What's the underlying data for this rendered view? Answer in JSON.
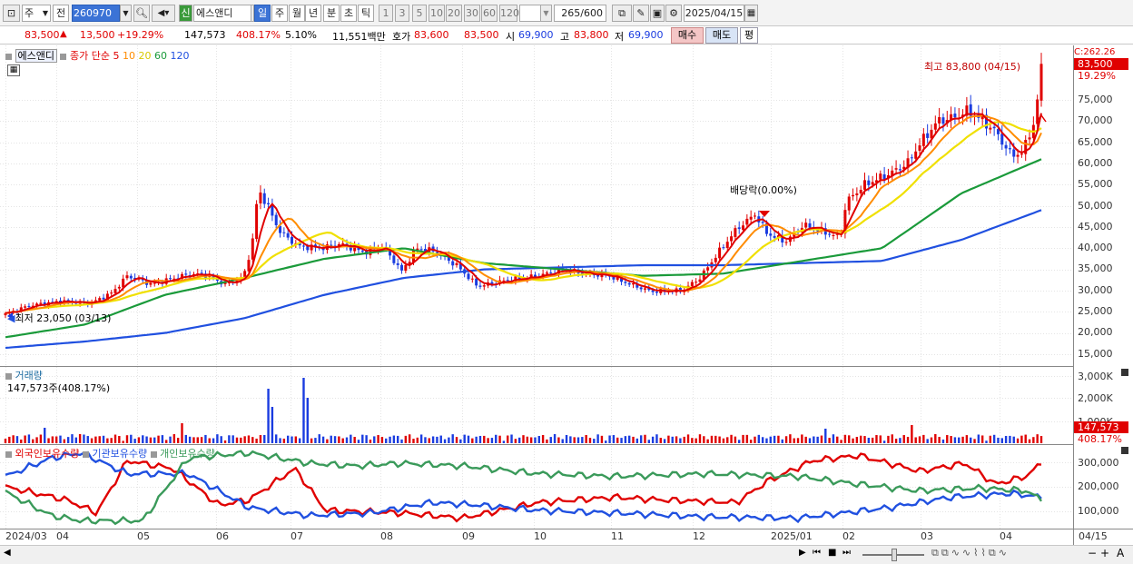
{
  "toolbar": {
    "mkt_label": "주",
    "prev_label": "전",
    "code": "260970",
    "new_badge": "신",
    "stock_name": "에스앤디",
    "periods": [
      "일",
      "주",
      "월",
      "년",
      "분",
      "초",
      "틱"
    ],
    "active_period": "일",
    "intervals": [
      "1",
      "3",
      "5",
      "10",
      "20",
      "30",
      "60",
      "120"
    ],
    "count_value": "265",
    "count_total": "/600",
    "date": "2025/04/15"
  },
  "quote": {
    "price": "83,500",
    "change": "13,500",
    "change_pct": "+19.29%",
    "volume": "147,573",
    "vol_ratio": "408.17%",
    "turnover": "5.10%",
    "amount": "11,551백만",
    "ask_label": "호가",
    "ask": "83,600",
    "bid": "83,500",
    "open_label": "시",
    "open": "69,900",
    "high_label": "고",
    "high": "83,800",
    "low_label": "저",
    "low": "69,900",
    "buy_label": "매수",
    "sell_label": "매도",
    "eval_label": "평"
  },
  "price_pane": {
    "legend_name": "에스앤디",
    "legend_close": "종가 단순 5",
    "legend_ma": [
      "10",
      "20",
      "60",
      "120"
    ],
    "y_labels": [
      "75,000",
      "70,000",
      "65,000",
      "60,000",
      "55,000",
      "50,000",
      "45,000",
      "40,000",
      "35,000",
      "30,000",
      "25,000",
      "20,000",
      "15,000"
    ],
    "cur_price_tag": "83,500",
    "cur_pct_tag": "19.29%",
    "top_tag": "C:262.26",
    "high_note": "최고 83,800 (04/15)",
    "low_note": "최저 23,050 (03/13)",
    "div_note": "배당락(0.00%)"
  },
  "vol_pane": {
    "title": "거래량",
    "value": "147,573주(408.17%)",
    "y_labels": [
      "3,000K",
      "2,000K",
      "1,000K"
    ],
    "cur_tag": "147,573",
    "pct_tag": "408.17%"
  },
  "hold_pane": {
    "legend": [
      "외국인보유수량",
      "기관보유수량",
      "개인보유수량"
    ],
    "y_labels": [
      "300,000",
      "200,000",
      "100,000"
    ]
  },
  "x_labels": [
    "2024/03",
    "04",
    "05",
    "06",
    "07",
    "08",
    "09",
    "10",
    "11",
    "12",
    "2025/01",
    "02",
    "03",
    "04"
  ],
  "x_right": "04/15",
  "colors": {
    "up": "#e00000",
    "down": "#1a3ce0",
    "ma5": "#e00000",
    "ma10": "#ff8c00",
    "ma20": "#f0e000",
    "ma60": "#1a9a3a",
    "ma120": "#2050e0",
    "foreign": "#e00000",
    "inst": "#2050e0",
    "retail": "#3a9a5a"
  },
  "chart_data": {
    "type": "line",
    "series": [
      {
        "name": "60",
        "x": [
          "2024/03",
          "04",
          "05",
          "06",
          "07",
          "08",
          "09",
          "10",
          "11",
          "12",
          "2025/01",
          "02",
          "03",
          "04/15"
        ],
        "values": [
          19000,
          22000,
          29000,
          33000,
          37500,
          40000,
          36500,
          35000,
          33500,
          34000,
          37000,
          40000,
          53000,
          61000
        ]
      },
      {
        "name": "120",
        "x": [
          "2024/03",
          "04",
          "05",
          "06",
          "07",
          "08",
          "09",
          "10",
          "11",
          "12",
          "2025/01",
          "02",
          "03",
          "04/15"
        ],
        "values": [
          16500,
          18000,
          20000,
          23500,
          29000,
          33000,
          35000,
          35500,
          36000,
          36000,
          36500,
          37000,
          42000,
          49000
        ]
      }
    ],
    "y_range": [
      15000,
      80000
    ]
  }
}
